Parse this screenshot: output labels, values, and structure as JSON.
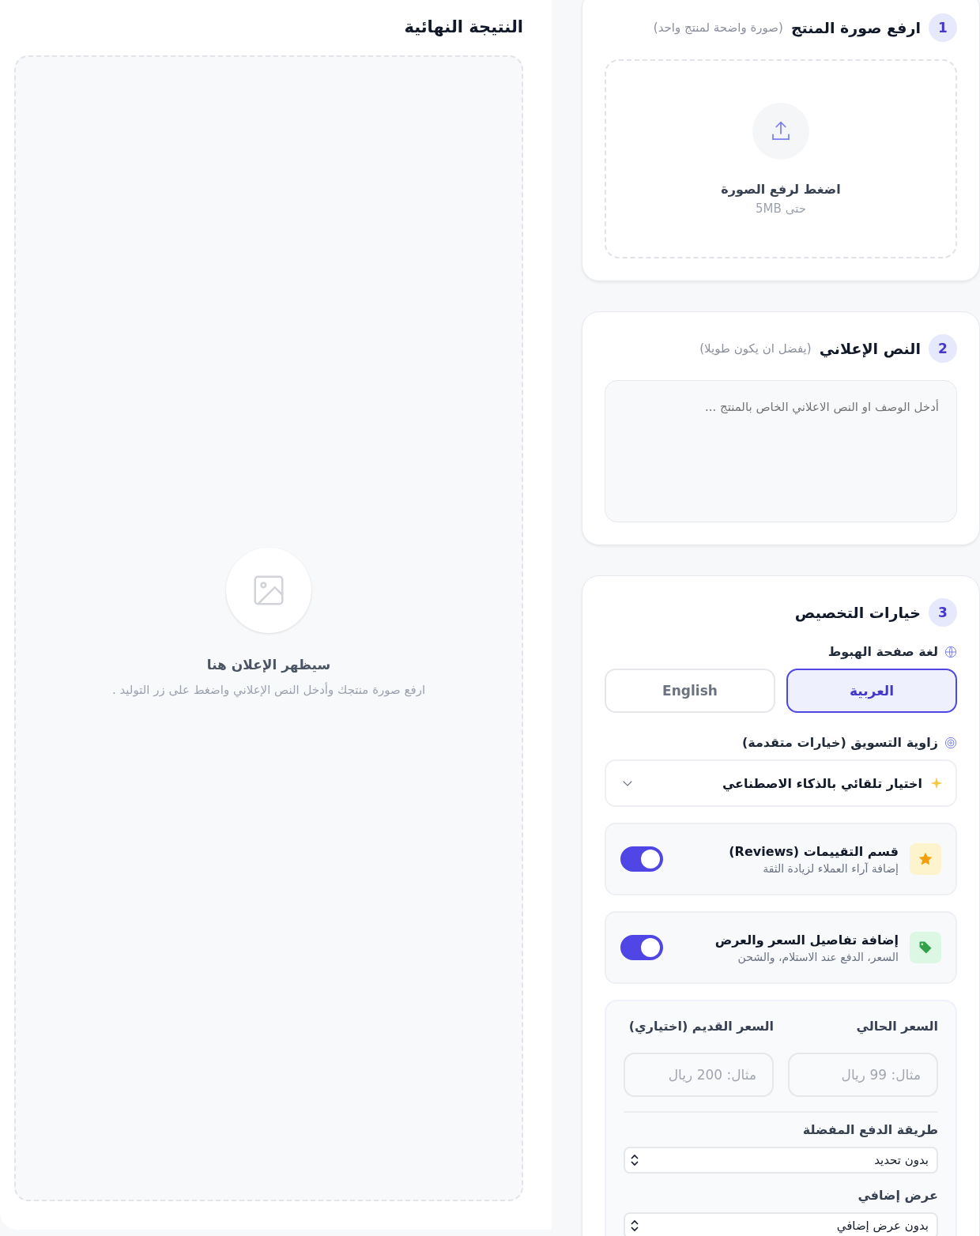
{
  "result": {
    "title": "النتيجة النهائية",
    "empty_title": "سيظهر الإعلان هنا",
    "empty_text": "ارفع صورة منتجك وأدخل النص الإعلاني واضغط على زر التوليد ."
  },
  "upload": {
    "number": "1",
    "title": "ارفع صورة المنتج",
    "hint": "(صورة واضحة لمنتج واحد)",
    "action": "اضغط لرفع الصورة",
    "limit": "حتى 5MB"
  },
  "ad_text": {
    "number": "2",
    "title": "النص الإعلاني",
    "hint": "(يفضل ان يكون طويلا)",
    "placeholder": "أدخل الوصف او النص الاعلاني الخاص بالمنتج ..."
  },
  "customization": {
    "number": "3",
    "title": "خيارات التخصيص",
    "language_label": "لغة صفحة الهبوط",
    "languages": [
      {
        "label": "العربية",
        "selected": true
      },
      {
        "label": "English",
        "selected": false
      }
    ],
    "angle_label": "زاوية التسويق (خيارات متقدمة)",
    "angle_value": "اختيار تلقائي بالذكاء الاصطناعي",
    "features": [
      {
        "kind": "star",
        "title": "قسم التقييمات (Reviews)",
        "subtitle": "إضافة آراء العملاء لزيادة الثقة",
        "on": true
      },
      {
        "kind": "tag",
        "title": "إضافة تفاصيل السعر والعرض",
        "subtitle": "السعر، الدفع عند الاستلام، والشحن",
        "on": true
      }
    ],
    "price": {
      "current_label": "السعر الحالي",
      "current_placeholder": "مثال: 99 ريال",
      "old_label": "السعر القديم (اختياري)",
      "old_placeholder": "مثال: 200 ريال",
      "payment_label": "طريقة الدفع المفضلة",
      "payment_value": "بدون تحديد",
      "offer_label": "عرض إضافي",
      "offer_value": "بدون عرض إضافي"
    }
  }
}
